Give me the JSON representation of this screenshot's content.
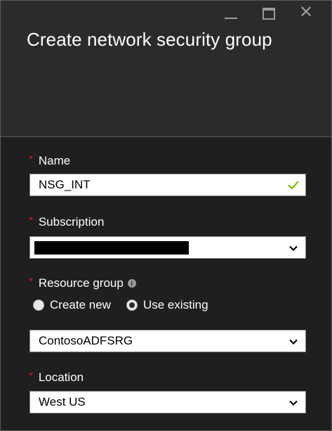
{
  "header": {
    "title": "Create network security group"
  },
  "form": {
    "required_marker": "*",
    "name": {
      "label": "Name",
      "value": "NSG_INT"
    },
    "subscription": {
      "label": "Subscription",
      "value": ""
    },
    "resource_group": {
      "label": "Resource group",
      "options": [
        "Create new",
        "Use existing"
      ],
      "selected": "Use existing",
      "value": "ContosoADFSRG"
    },
    "location": {
      "label": "Location",
      "value": "West US"
    }
  },
  "icons": {
    "window": [
      "minimize-icon",
      "maximize-icon",
      "close-icon"
    ],
    "valid": "check-icon",
    "dropdown": "chevron-down-icon",
    "info": "info-icon"
  },
  "colors": {
    "panel_bg": "#1f1f1f",
    "header_bg": "#2b2b2b",
    "required": "#e81123",
    "valid": "#7fba00"
  }
}
